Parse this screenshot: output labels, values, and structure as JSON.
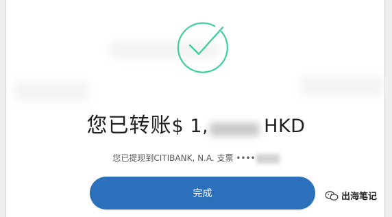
{
  "colors": {
    "accent_blue": "#2c6fba",
    "success_green": "#3ecf9b",
    "text_dark": "#1f1f1f",
    "text_secondary": "#5a5a5a"
  },
  "success": {
    "icon": "check-circle-icon"
  },
  "title": {
    "prefix": "您已转账",
    "amount_visible_start": "$ 1,",
    "currency": "HKD"
  },
  "detail": {
    "text": "您已提现到CITIBANK, N.A. 支票 ••••"
  },
  "done_button": {
    "label": "完成"
  },
  "watermark": {
    "icon": "wechat-icon",
    "text": "出海笔记"
  }
}
